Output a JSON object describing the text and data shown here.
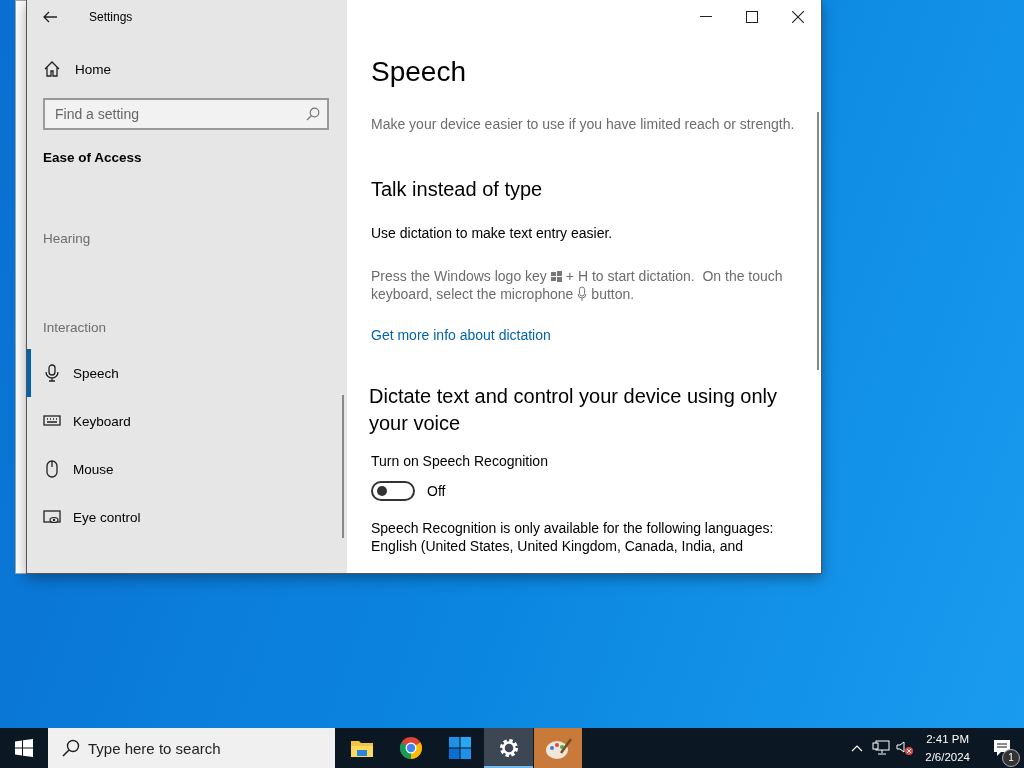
{
  "window": {
    "title": "Settings"
  },
  "sidebar": {
    "home": "Home",
    "search": {
      "placeholder": "Find a setting"
    },
    "category": "Ease of Access",
    "sections": [
      {
        "heading": "Hearing"
      },
      {
        "heading": "Interaction",
        "items": [
          {
            "label": "Speech",
            "selected": true
          },
          {
            "label": "Keyboard",
            "selected": false
          },
          {
            "label": "Mouse",
            "selected": false
          },
          {
            "label": "Eye control",
            "selected": false
          }
        ]
      }
    ]
  },
  "content": {
    "title": "Speech",
    "subtitle": "Make your device easier to use if you have limited reach or strength.",
    "sections": [
      {
        "heading": "Talk instead of type",
        "text": "Use dictation to make text entry easier.",
        "hint_parts": [
          "Press the Windows logo key",
          "+ H to start dictation.  On the touch",
          "keyboard, select the microphone",
          "button."
        ],
        "link": "Get more info about dictation"
      },
      {
        "heading": "Dictate text and control your device using only your voice",
        "toggle": {
          "label": "Turn on Speech Recognition",
          "on": false,
          "state_text": "Off"
        },
        "note": "Speech Recognition is only available for the following languages: English (United States, United Kingdom, Canada, India, and"
      }
    ]
  },
  "taskbar": {
    "search": {
      "placeholder": "Type here to search"
    },
    "apps": [
      {
        "selected": false
      },
      {
        "selected": false
      },
      {
        "selected": false
      },
      {
        "selected": true
      },
      {
        "selected": false
      }
    ],
    "clock": {
      "time": "2:41 PM",
      "date": "2/6/2024"
    },
    "notifications": "1"
  }
}
